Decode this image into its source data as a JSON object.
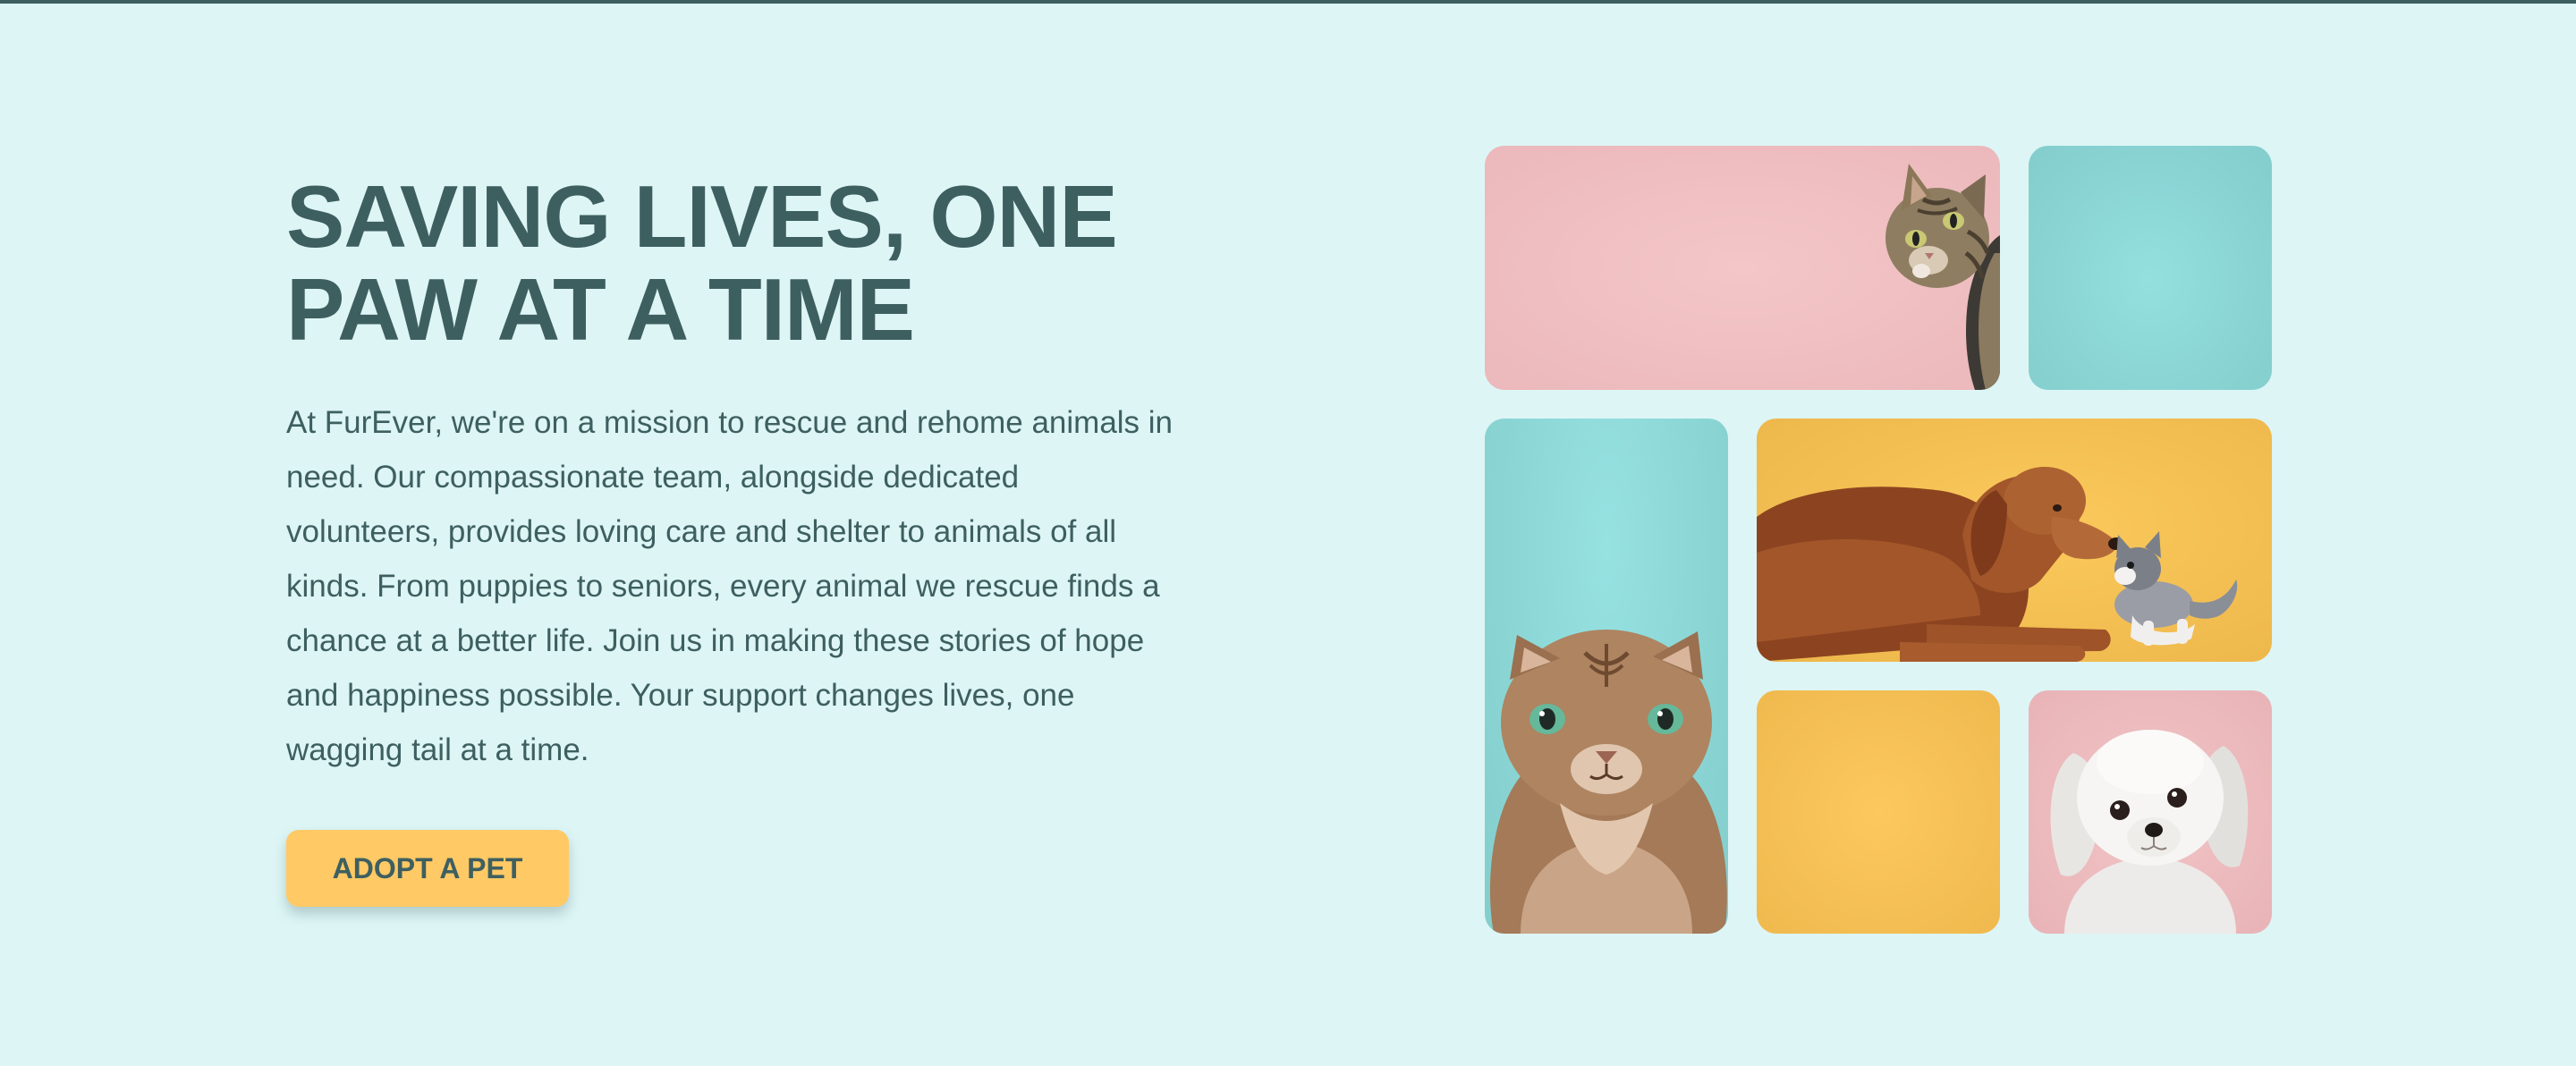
{
  "hero": {
    "title_line1": "SAVING LIVES, ONE",
    "title_line2": "PAW AT A TIME",
    "description": "At FurEver, we're on a mission to rescue and rehome animals in need. Our compassionate team, alongside dedicated volunteers, provides loving care and shelter to animals of all kinds. From puppies to seniors, every animal we rescue finds a chance at a better life. Join us in making these stories of hope and happiness possible. Your support changes lives, one wagging tail at a time.",
    "button_label": "ADOPT A PET"
  },
  "colors": {
    "background": "#ddf5f5",
    "text": "#3e5f60",
    "accent": "#ffc965",
    "pink": "#f0bfc1",
    "teal": "#8dd6d5",
    "yellow": "#f5bf55"
  },
  "gallery": {
    "tiles": [
      {
        "icon": "peeking-tabby-cat",
        "background": "pink"
      },
      {
        "icon": "none",
        "background": "teal"
      },
      {
        "icon": "fluffy-tabby-cat",
        "background": "teal"
      },
      {
        "icon": "golden-retriever-and-kitten",
        "background": "yellow"
      },
      {
        "icon": "none",
        "background": "yellow"
      },
      {
        "icon": "white-puppy",
        "background": "pink"
      }
    ]
  }
}
